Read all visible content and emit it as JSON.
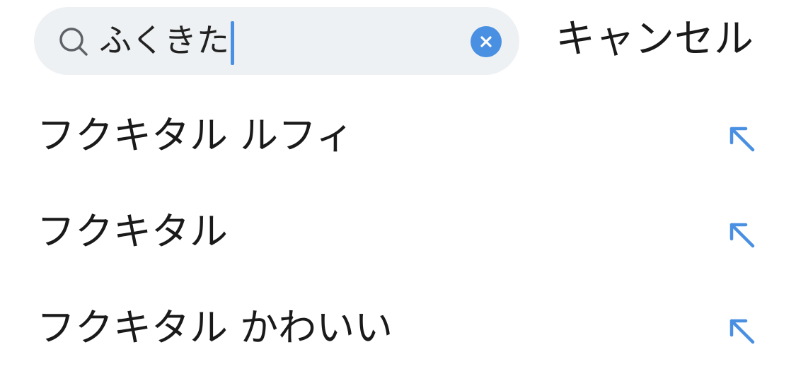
{
  "search": {
    "query": "ふくきた",
    "cancel_label": "キャンセル",
    "icon": "search-icon",
    "clear_icon": "clear-icon"
  },
  "suggestions": [
    {
      "label": "フクキタル ルフィ",
      "icon": "fill-query-arrow-icon"
    },
    {
      "label": "フクキタル",
      "icon": "fill-query-arrow-icon"
    },
    {
      "label": "フクキタル かわいい",
      "icon": "fill-query-arrow-icon"
    }
  ],
  "colors": {
    "accent": "#4a90e2",
    "search_background": "#eef1f3",
    "text": "#1a1a1a"
  }
}
